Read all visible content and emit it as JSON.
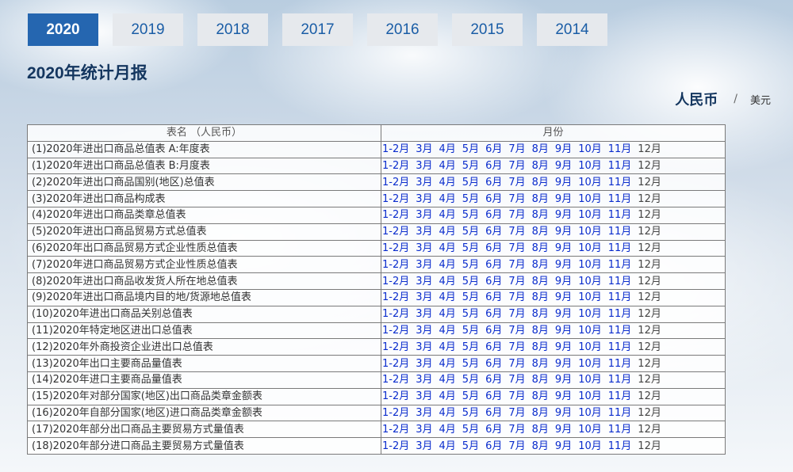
{
  "year_tabs": [
    {
      "label": "2020",
      "active": true
    },
    {
      "label": "2019",
      "active": false
    },
    {
      "label": "2018",
      "active": false
    },
    {
      "label": "2017",
      "active": false
    },
    {
      "label": "2016",
      "active": false
    },
    {
      "label": "2015",
      "active": false
    },
    {
      "label": "2014",
      "active": false
    }
  ],
  "page_title": "2020年统计月报",
  "currency": {
    "active": "人民币",
    "separator": "/",
    "other": "美元"
  },
  "table": {
    "header_name": "表名 （人民币）",
    "header_months": "月份",
    "months": [
      "1-2月",
      "3月",
      "4月",
      "5月",
      "6月",
      "7月",
      "8月",
      "9月",
      "10月",
      "11月",
      "12月"
    ],
    "linked_months": 10,
    "rows": [
      "(1)2020年进出口商品总值表 A:年度表",
      "(1)2020年进出口商品总值表 B:月度表",
      "(2)2020年进出口商品国别(地区)总值表",
      "(3)2020年进出口商品构成表",
      "(4)2020年进出口商品类章总值表",
      "(5)2020年进出口商品贸易方式总值表",
      "(6)2020年出口商品贸易方式企业性质总值表",
      "(7)2020年进口商品贸易方式企业性质总值表",
      "(8)2020年进出口商品收发货人所在地总值表",
      "(9)2020年进出口商品境内目的地/货源地总值表",
      "(10)2020年进出口商品关别总值表",
      "(11)2020年特定地区进出口总值表",
      "(12)2020年外商投资企业进出口总值表",
      "(13)2020年出口主要商品量值表",
      "(14)2020年进口主要商品量值表",
      "(15)2020年对部分国家(地区)出口商品类章金额表",
      "(16)2020年自部分国家(地区)进口商品类章金额表",
      "(17)2020年部分出口商品主要贸易方式量值表",
      "(18)2020年部分进口商品主要贸易方式量值表"
    ]
  }
}
